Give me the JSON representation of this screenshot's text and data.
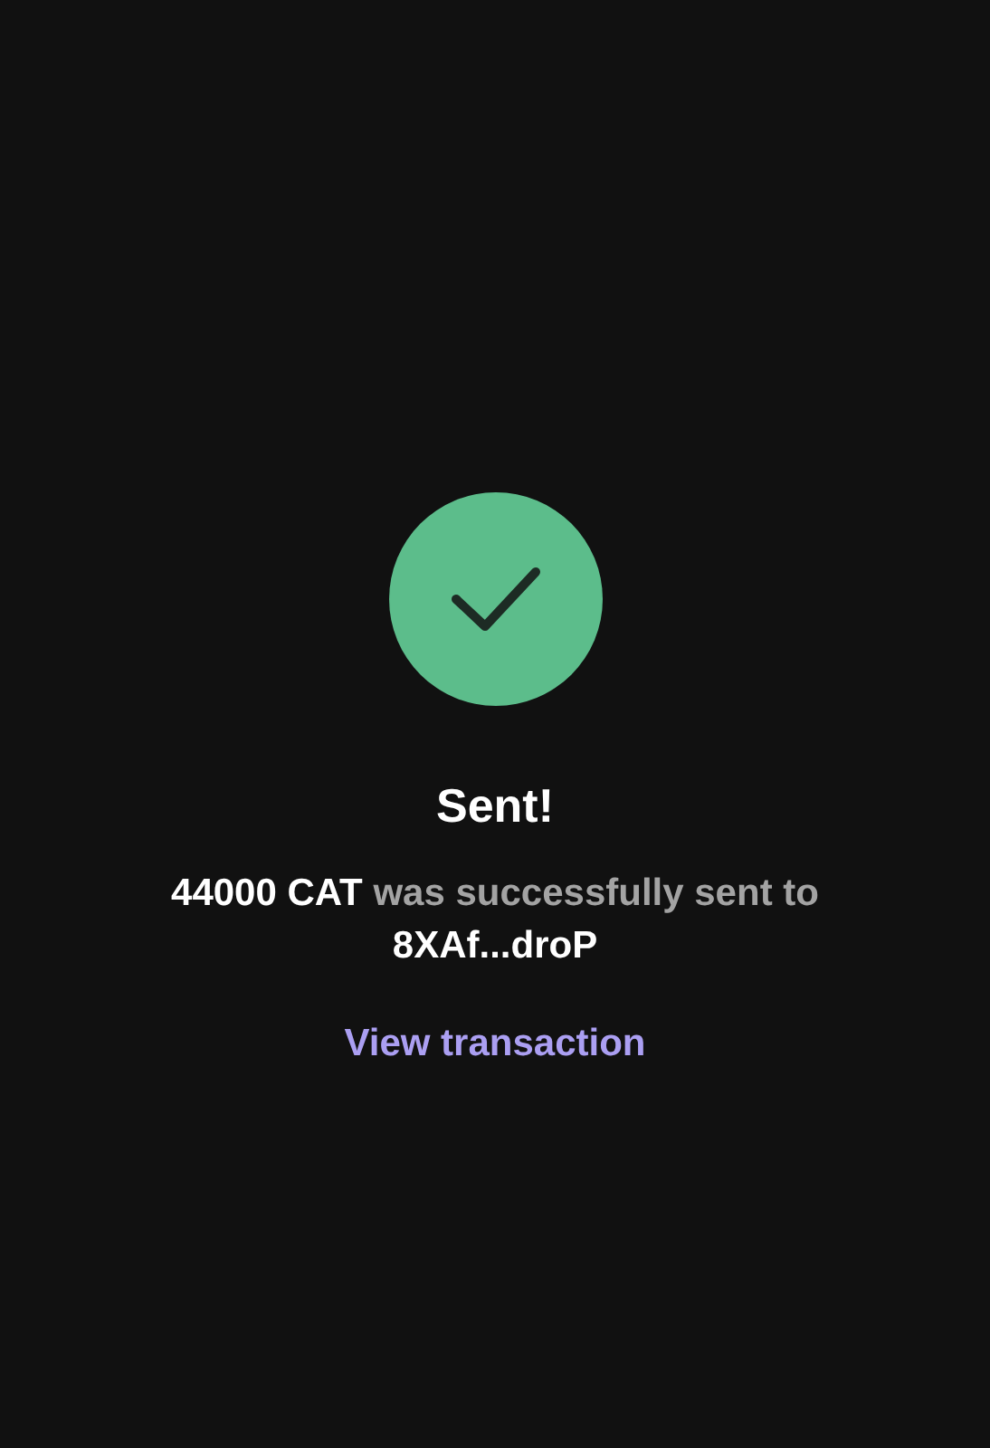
{
  "status": {
    "kind": "success",
    "title": "Sent!"
  },
  "message": [
    {
      "text": "44000 CAT",
      "highlight": true
    },
    {
      "text": " was successfully sent to ",
      "highlight": false
    },
    {
      "text": "8XAf...droP",
      "highlight": true
    }
  ],
  "link": {
    "label": "View transaction"
  }
}
